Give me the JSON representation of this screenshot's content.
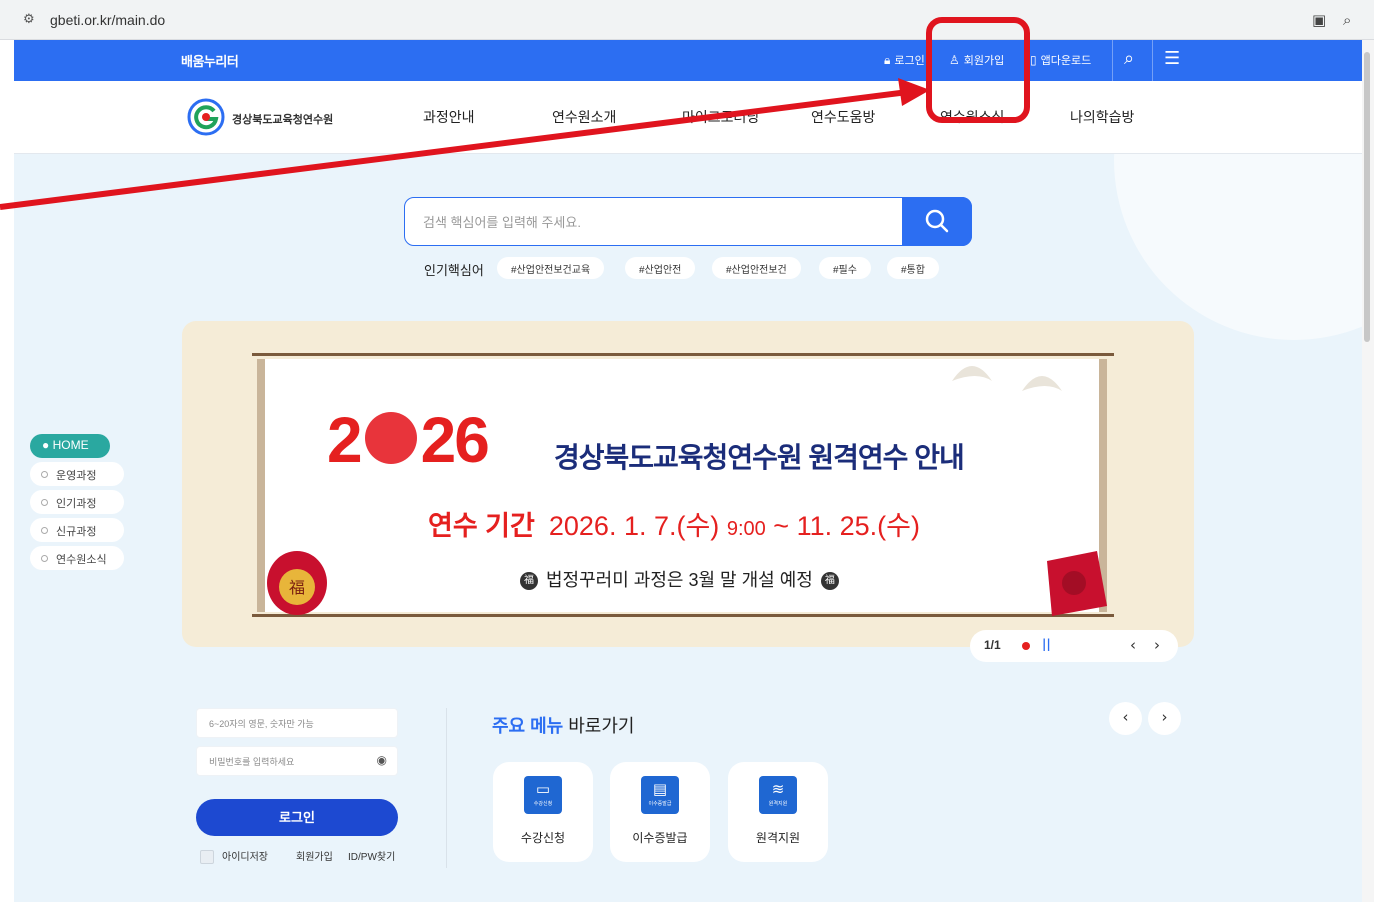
{
  "browser": {
    "url": "gbeti.or.kr/main.do"
  },
  "topbar": {
    "brand": "배움누리터",
    "login": "로그인",
    "signup": "회원가입",
    "app_download": "앱다운로드"
  },
  "nav": {
    "logo_text": "경상북도교육청연수원",
    "items": [
      "과정안내",
      "연수원소개",
      "마이크로러닝",
      "연수도움방",
      "연수원소식",
      "나의학습방"
    ]
  },
  "search": {
    "placeholder": "검색 핵심어를 입력해 주세요.",
    "popular_label": "인기핵심어",
    "tags": [
      "#산업안전보건교육",
      "#산업안전",
      "#산업안전보건",
      "#필수",
      "#통합"
    ]
  },
  "banner": {
    "year_left": "2",
    "year_right": "26",
    "title": "경상북도교육청연수원 원격연수 안내",
    "period_label": "연수 기간",
    "period_start": "2026. 1. 7.(수)",
    "period_time": "9:00",
    "period_tilde": "~",
    "period_end": "11. 25.(수)",
    "note": "법정꾸러미 과정은 3월 말 개설 예정",
    "fortune_char": "福",
    "pager_text": "1/1"
  },
  "quick_nav": {
    "home": "HOME",
    "items": [
      "운영과정",
      "인기과정",
      "신규과정",
      "연수원소식"
    ]
  },
  "login": {
    "id_placeholder": "6~20자의 영문, 숫자만 가능",
    "pw_placeholder": "비밀번호를 입력하세요",
    "button": "로그인",
    "remember": "아이디저장",
    "join": "회원가입",
    "find": "ID/PW찾기"
  },
  "quick_menu": {
    "title_bold": "주요 메뉴",
    "title_rest": " 바로가기",
    "items": [
      {
        "label": "수강신청",
        "icon_label": "수강신청",
        "icon": "monitor-icon"
      },
      {
        "label": "이수증발급",
        "icon_label": "이수증발급",
        "icon": "document-icon"
      },
      {
        "label": "원격지원",
        "icon_label": "원격지원",
        "icon": "wifi-icon"
      }
    ]
  },
  "colors": {
    "primary": "#2c6ef2",
    "annotation": "#e0141e",
    "banner_red": "#e5201f",
    "banner_navy": "#1b2d7a"
  }
}
